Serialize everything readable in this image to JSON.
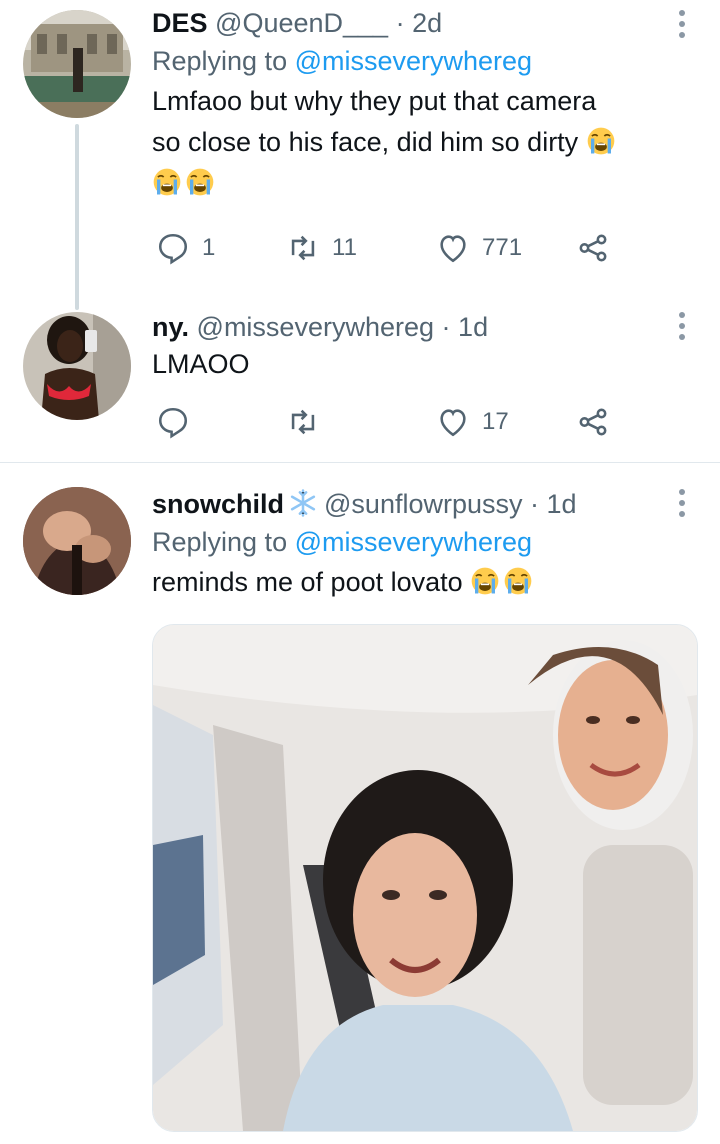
{
  "tweets": [
    {
      "name": "DES",
      "handle": "@QueenD___",
      "dot": "·",
      "time": "2d",
      "replying_prefix": "Replying to ",
      "replying_to": "@misseverywhereg",
      "text_line1": "Lmfaoo but why they put that camera",
      "text_line2": "so close to his face, did him so dirty",
      "emoji": "loudly-crying-face",
      "reply_count": "1",
      "retweet_count": "11",
      "like_count": "771"
    },
    {
      "name": "ny.",
      "handle": "@misseverywhereg",
      "dot": "·",
      "time": "1d",
      "text": "LMAOO",
      "reply_count": "",
      "retweet_count": "",
      "like_count": "17"
    },
    {
      "name": "snowchild",
      "name_icon": "snowflake-icon",
      "handle": "@sunflowrpussy",
      "dot": "·",
      "time": "1d",
      "replying_prefix": "Replying to ",
      "replying_to": "@misseverywhereg",
      "text": "reminds me of poot lovato",
      "emoji": "loudly-crying-face"
    }
  ],
  "colors": {
    "accent": "#1d9bf0",
    "secondary_text": "#536471",
    "thread_line": "#cfd9de"
  }
}
